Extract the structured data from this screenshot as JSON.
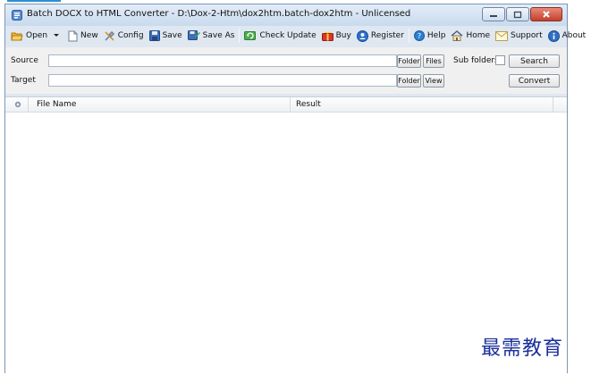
{
  "window": {
    "title": "Batch DOCX to HTML Converter - D:\\Dox-2-Htm\\dox2htm.batch-dox2htm - Unlicensed"
  },
  "toolbar": {
    "open": "Open",
    "new": "New",
    "config": "Config",
    "save": "Save",
    "save_as": "Save As",
    "check_update": "Check Update",
    "buy": "Buy",
    "register": "Register",
    "help": "Help",
    "home": "Home",
    "support": "Support",
    "about": "About"
  },
  "source": {
    "label": "Source",
    "value": "",
    "folder_button": "Folder",
    "files_button": "Files",
    "subfolders_label": "Sub folders",
    "subfolders_checked": false,
    "search_button": "Search"
  },
  "target": {
    "label": "Target",
    "value": "",
    "folder_button": "Folder",
    "view_button": "View",
    "convert_button": "Convert"
  },
  "grid": {
    "columns": [
      "File Name",
      "Result"
    ],
    "rows": []
  },
  "watermark": "最需教育",
  "colors": {
    "titlebar": "#c9daee",
    "frame": "#7e96b6",
    "accent": "#2b8fd4",
    "watermark": "#1a2f9a"
  }
}
